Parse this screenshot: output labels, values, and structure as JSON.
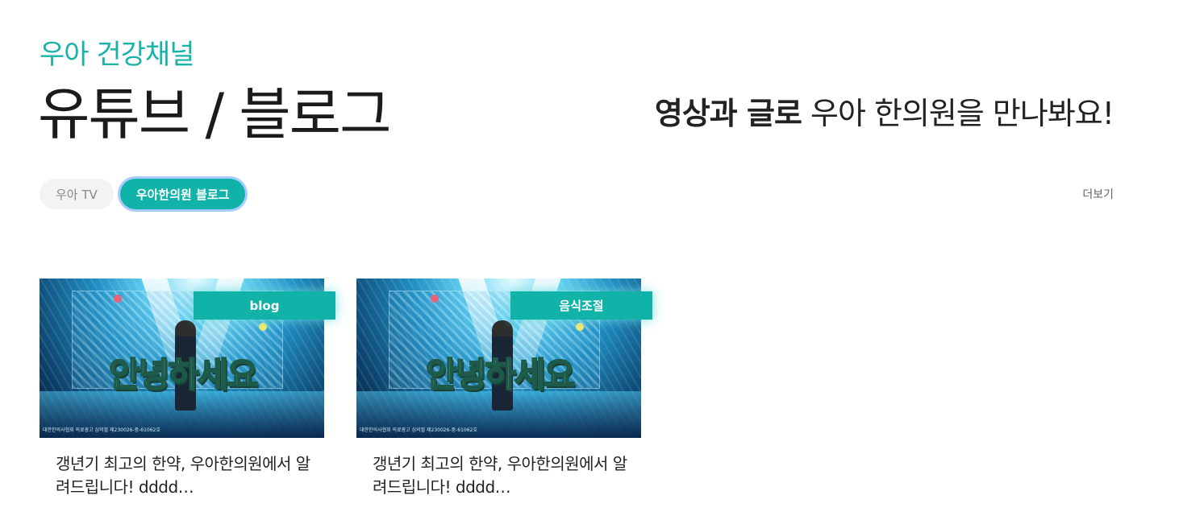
{
  "header": {
    "eyebrow": "우아 건강채널",
    "title": "유튜브 / 블로그",
    "tagline_bold": "영상과 글로",
    "tagline_rest": " 우아 한의원을 만나봐요!"
  },
  "tabs": [
    {
      "label": "우아 TV",
      "active": false
    },
    {
      "label": "우아한의원 블로그",
      "active": true
    }
  ],
  "more_label": "더보기",
  "colors": {
    "accent": "#11b3a8",
    "eyebrow": "#17b3a8",
    "tab_focus_ring": "#a9ccff"
  },
  "cards": [
    {
      "badge": "blog",
      "thumb_text": "안녕하세요",
      "thumb_fine_print": "대한한의사협회 의료광고 심의필 제230026-중-61062호",
      "title": "갱년기 최고의 한약, 우아한의원에서 알려드립니다! dddd…"
    },
    {
      "badge": "음식조절",
      "thumb_text": "안녕하세요",
      "thumb_fine_print": "대한한의사협회 의료광고 심의필 제230026-중-61062호",
      "title": "갱년기 최고의 한약, 우아한의원에서 알려드립니다! dddd…"
    }
  ]
}
